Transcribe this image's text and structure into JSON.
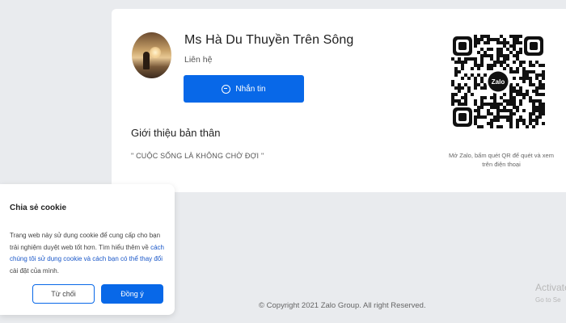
{
  "profile": {
    "name": "Ms Hà Du Thuyền Trên Sông",
    "relation": "Liên hệ",
    "message_button": "Nhắn tin",
    "intro_title": "Giới thiệu bản thân",
    "intro_text": "\" CUỘC SỐNG LÀ KHÔNG CHỜ ĐỢI \""
  },
  "qr": {
    "logo_text": "Zalo",
    "caption": "Mở Zalo, bấm quét QR để quét và xem trên điện thoại"
  },
  "cookie": {
    "title": "Chia sẻ cookie",
    "body_part1": "Trang web này sử dụng cookie để cung cấp cho bạn trải nghiệm duyệt web tốt hơn. Tìm hiểu thêm về ",
    "body_link": "cách chúng tôi sử dụng cookie và cách bạn có thể thay đổi",
    "body_part2": " cài đặt của mình.",
    "decline": "Từ chối",
    "accept": "Đồng ý"
  },
  "footer": {
    "copyright": "© Copyright 2021 Zalo Group. All right Reserved."
  },
  "watermark": {
    "line1": "Activate",
    "line2": "Go to Se"
  },
  "colors": {
    "accent": "#0868e8",
    "background": "#e9ebee"
  }
}
